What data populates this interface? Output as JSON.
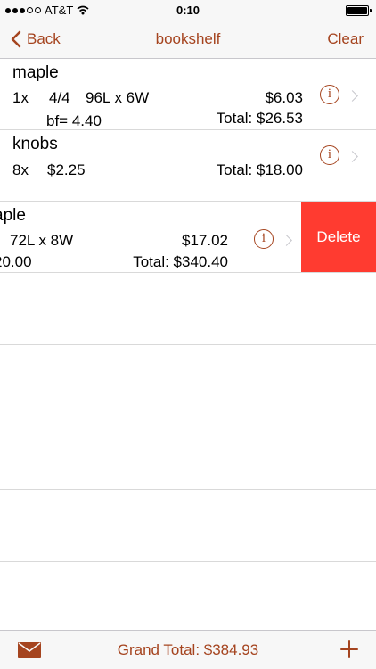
{
  "status": {
    "carrier": "AT&T",
    "time": "0:10"
  },
  "nav": {
    "back_label": "Back",
    "title": "bookshelf",
    "clear_label": "Clear"
  },
  "rows": [
    {
      "name": "maple",
      "qty": "1x",
      "thickness": "4/4",
      "dims": "96L x 6W",
      "price": "$6.03",
      "bf": "bf= 4.40",
      "total": "Total: $26.53"
    },
    {
      "name": "knobs",
      "qty": "8x",
      "price": "$2.25",
      "total": "Total: $18.00"
    },
    {
      "name_partial": "aple",
      "dims": "72L x 8W",
      "price": "$17.02",
      "bf_partial": "20.00",
      "total": "Total: $340.40",
      "delete_label": "Delete"
    }
  ],
  "toolbar": {
    "grand_total": "Grand Total: $384.93"
  },
  "icons": [
    "signal-dots-icon",
    "wifi-icon",
    "battery-icon",
    "chevron-left-icon",
    "info-icon",
    "chevron-right-icon",
    "mail-icon",
    "plus-icon"
  ],
  "colors": {
    "accent": "#a5441f",
    "delete": "#ff3b30",
    "bar_bg": "#f7f7f7"
  }
}
